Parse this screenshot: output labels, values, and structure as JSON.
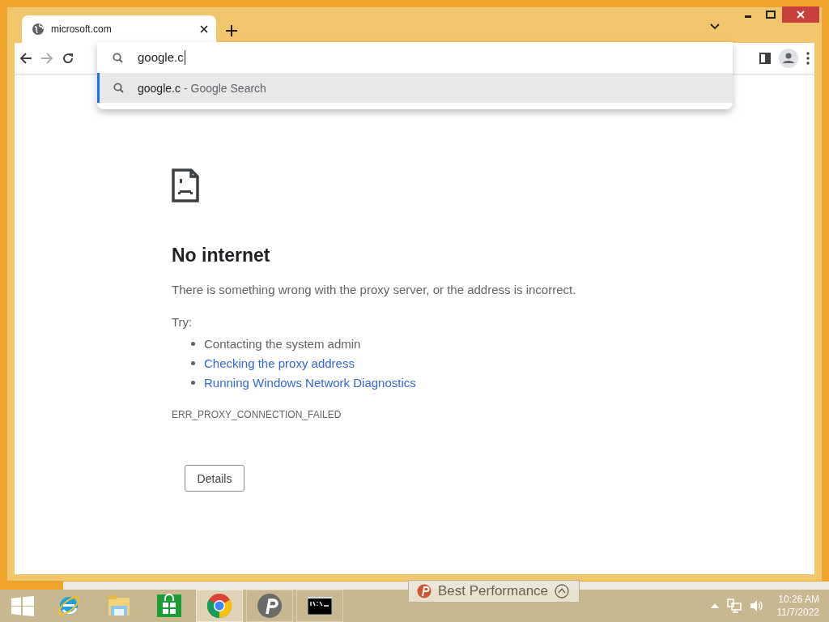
{
  "tab": {
    "title": "microsoft.com",
    "selected": true
  },
  "omnibox": {
    "value": "google.c",
    "suggestions": [
      {
        "query": "google.c",
        "detail": "- Google Search",
        "selected": true
      }
    ]
  },
  "error": {
    "title": "No internet",
    "message": "There is something wrong with the proxy server, or the address is incorrect.",
    "try_label": "Try:",
    "suggestions": [
      {
        "text": "Contacting the system admin",
        "kind": "text"
      },
      {
        "text": "Checking the proxy address",
        "kind": "link"
      },
      {
        "text": "Running Windows Network Diagnostics",
        "kind": "link"
      }
    ],
    "code": "ERR_PROXY_CONNECTION_FAILED",
    "button": "Details"
  },
  "notification": {
    "text": "Best Performance"
  },
  "taskbar": {
    "apps": [
      {
        "kind": "ie",
        "running": false,
        "selected": false
      },
      {
        "kind": "explorer",
        "running": false,
        "selected": false
      },
      {
        "kind": "store",
        "running": false,
        "selected": false
      },
      {
        "kind": "chrome",
        "running": true,
        "selected": true
      },
      {
        "kind": "psiphon",
        "running": true,
        "selected": false
      },
      {
        "kind": "terminal",
        "running": true,
        "selected": false
      }
    ],
    "time": "10:26 AM",
    "date": "11/7/2022"
  }
}
